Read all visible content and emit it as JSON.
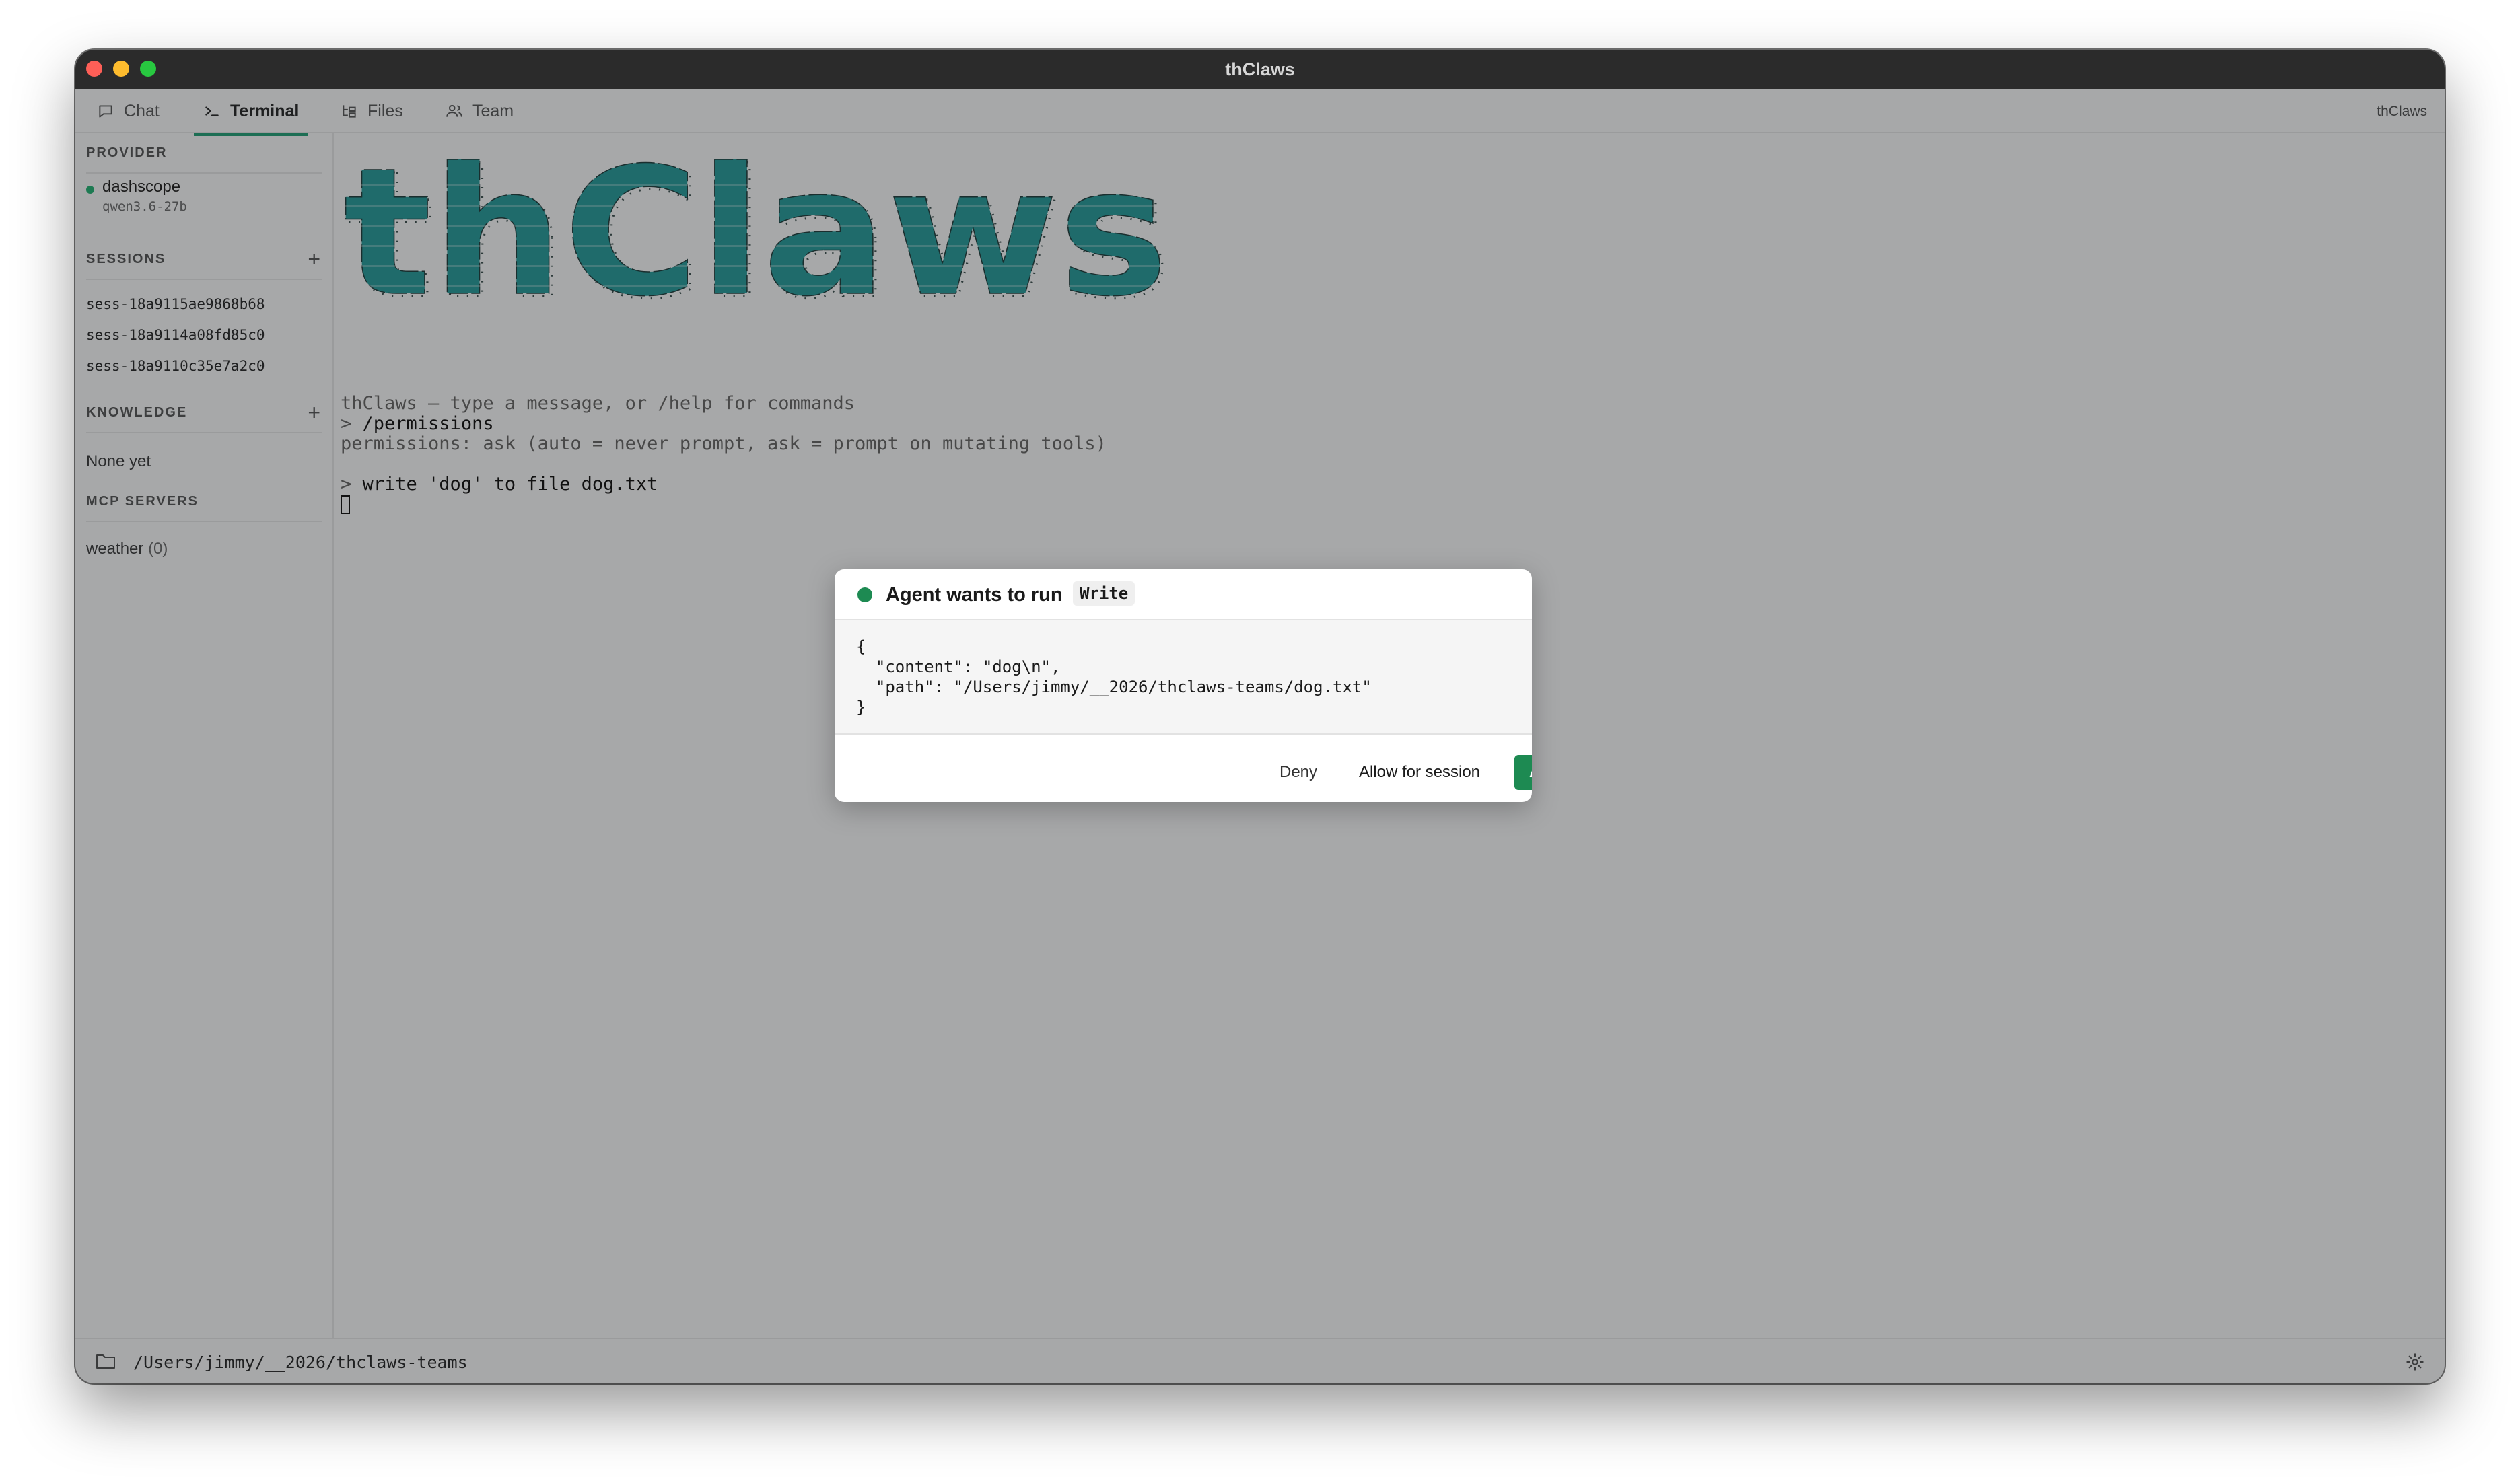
{
  "window": {
    "title": "thClaws"
  },
  "tabs": [
    {
      "label": "Chat",
      "icon": "chat-bubble-icon",
      "active": false
    },
    {
      "label": "Terminal",
      "icon": "terminal-prompt-icon",
      "active": true
    },
    {
      "label": "Files",
      "icon": "file-tree-icon",
      "active": false
    },
    {
      "label": "Team",
      "icon": "team-icon",
      "active": false
    }
  ],
  "app_label": "thClaws",
  "sidebar": {
    "provider": {
      "heading": "PROVIDER",
      "name": "dashscope",
      "model": "qwen3.6-27b",
      "status_color": "#1d7a52"
    },
    "sessions": {
      "heading": "SESSIONS",
      "add": "+",
      "items": [
        "sess-18a9115ae9868b68",
        "sess-18a9114a08fd85c0",
        "sess-18a9110c35e7a2c0"
      ]
    },
    "knowledge": {
      "heading": "KNOWLEDGE",
      "add": "+",
      "empty": "None yet"
    },
    "mcp": {
      "heading": "MCP SERVERS",
      "items": [
        {
          "name": "weather",
          "count": "(0)"
        }
      ]
    }
  },
  "terminal": {
    "banner_text": "thClaws",
    "banner_color": "#1f6b6b",
    "lines": [
      {
        "text": "thClaws — type a message, or /help for commands",
        "kind": "info"
      },
      {
        "prompt": "> ",
        "text": "/permissions",
        "kind": "input"
      },
      {
        "text": "permissions: ask (auto = never prompt, ask = prompt on mutating tools)",
        "kind": "info"
      },
      {
        "prompt": "> ",
        "text": "write 'dog' to file dog.txt",
        "kind": "input"
      }
    ]
  },
  "statusbar": {
    "path": "/Users/jimmy/__2026/thclaws-teams"
  },
  "modal": {
    "title": "Agent wants to run",
    "tool": "Write",
    "code": "{\n  \"content\": \"dog\\n\",\n  \"path\": \"/Users/jimmy/__2026/thclaws-teams/dog.txt\"\n}",
    "buttons": {
      "deny": "Deny",
      "allow_session": "Allow for session",
      "allow": "Allow"
    },
    "accent": "#1d8a52"
  }
}
